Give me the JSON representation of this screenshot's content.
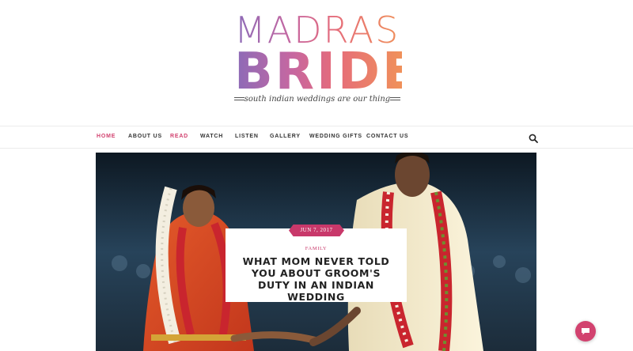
{
  "brand": {
    "name_line1": "MADRASI",
    "name_line2": "BRIDE",
    "tagline": "south indian weddings are our thing"
  },
  "nav": {
    "items": [
      {
        "label": "HOME",
        "active": true
      },
      {
        "label": "ABOUT US",
        "active": false
      },
      {
        "label": "READ",
        "active": true
      },
      {
        "label": "WATCH",
        "active": false
      },
      {
        "label": "LISTEN",
        "active": false
      },
      {
        "label": "GALLERY",
        "active": false
      },
      {
        "label": "WEDDING GIFTS",
        "active": false
      },
      {
        "label": "CONTACT US",
        "active": false
      }
    ],
    "search_icon": "search-icon"
  },
  "featured_post": {
    "date": "JUN 7, 2017",
    "category": "FAMILY",
    "title": "WHAT MOM NEVER TOLD YOU ABOUT GROOM'S DUTY IN AN INDIAN WEDDING",
    "image": "bride-and-groom-holding-hands-photo"
  },
  "chat": {
    "icon": "chat-bubble-icon"
  },
  "colors": {
    "accent": "#d2426f",
    "ribbon": "#c8386a",
    "text": "#333333"
  }
}
